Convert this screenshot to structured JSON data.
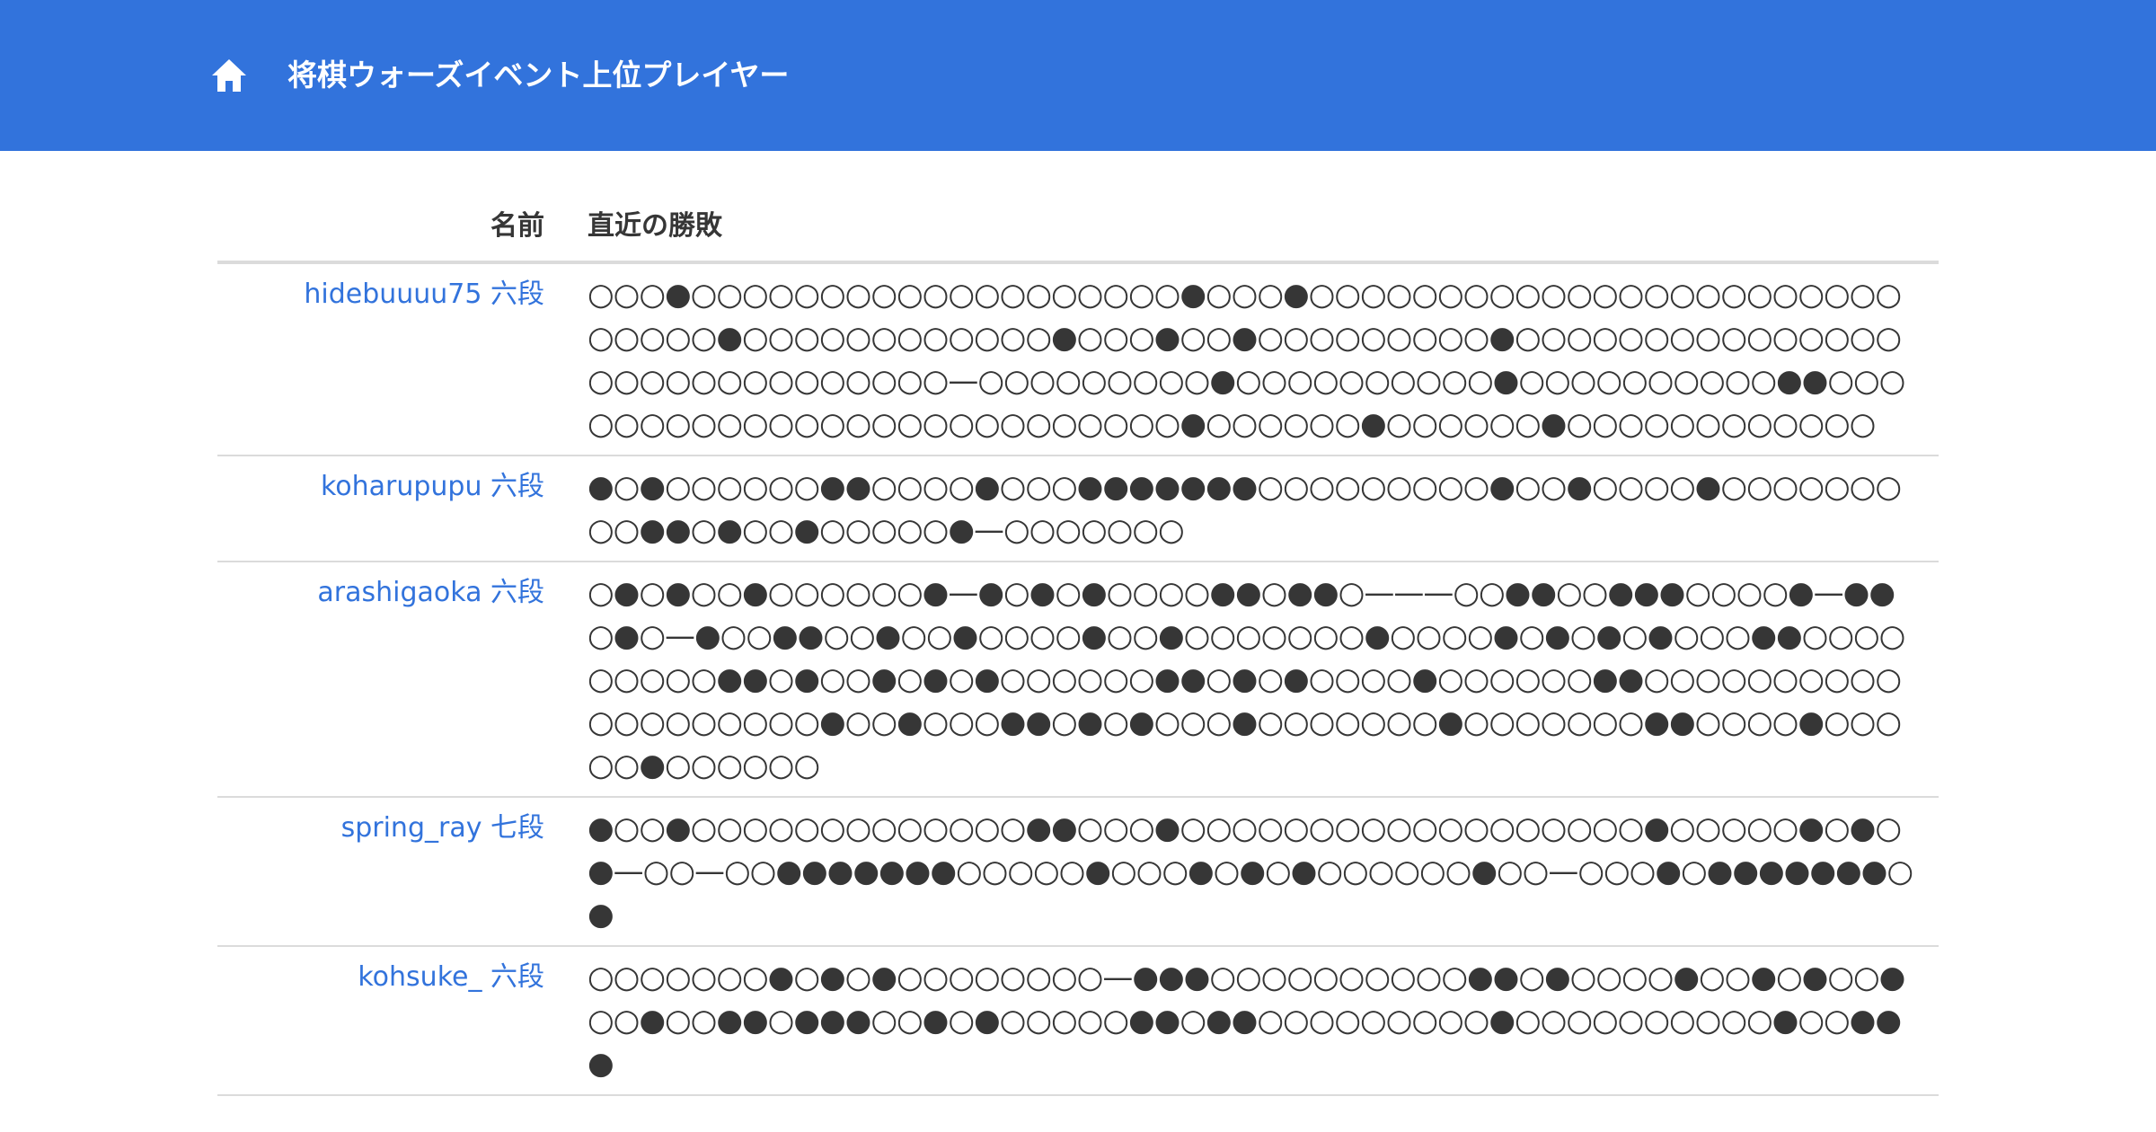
{
  "navbar": {
    "title": "将棋ウォーズイベント上位プレイヤー",
    "home_icon": "home-icon"
  },
  "table": {
    "headers": {
      "name": "名前",
      "results": "直近の勝敗"
    },
    "rows": [
      {
        "player": "hidebuuuu75 六段",
        "results": "○○○●○○○○○○○○○○○○○○○○○○○●○○○●○○○○○○○○○○○○○○○○○○○○○○○○○○○○●○○○○○○○○○○○○●○○○●○○●○○○○○○○○○●○○○○○○○○○○○○○○○○○○○○○○○○○○○○○—○○○○○○○○○●○○○○○○○○○○●○○○○○○○○○○●●○○○○○○○○○○○○○○○○○○○○○○○○○○●○○○○○○●○○○○○○●○○○○○○○○○○○○"
      },
      {
        "player": "koharupupu 六段",
        "results": "●○●○○○○○○●●○○○○●○○○●●●●●●●○○○○○○○○○●○○●○○○○●○○○○○○○○○●●○●○○●○○○○○●—○○○○○○○"
      },
      {
        "player": "arashigaoka 六段",
        "results": "○●○●○○●○○○○○○●—●○●○●○○○○●●○●●○———○○●●○○●●●○○○○●—●●○●○—●○○●●○○●○○●○○○○●○○●○○○○○○○●○○○○●○●○●○●○○○●●○○○○○○○○○●●○●○○●○●○●○○○○○○●●○●○●○○○○●○○○○○○●●○○○○○○○○○○○○○○○○○○○●○○●○○○●●○●○●○○○●○○○○○○○●○○○○○○○●●○○○○●○○○○○●○○○○○○"
      },
      {
        "player": "spring_ray 七段",
        "results": "●○○●○○○○○○○○○○○○○●●○○○●○○○○○○○○○○○○○○○○○○●○○○○○●○●○●—○○—○○●●●●●●●○○○○○●○○○●○●○●○○○○○○●○○—○○○●○●●●●●●●○●"
      },
      {
        "player": "kohsuke_ 六段",
        "results": "○○○○○○○●○●○●○○○○○○○○—●●●○○○○○○○○○○●●○●○○○○●○○●○●○○●○○●○○●●○●●●○○●○●○○○○○●●○●●○○○○○○○○○●○○○○○○○○○○●○○●●●"
      }
    ]
  },
  "colors": {
    "navbar_bg": "#3273dc",
    "link": "#3273dc",
    "text": "#363636",
    "border": "#dbdbdb"
  }
}
